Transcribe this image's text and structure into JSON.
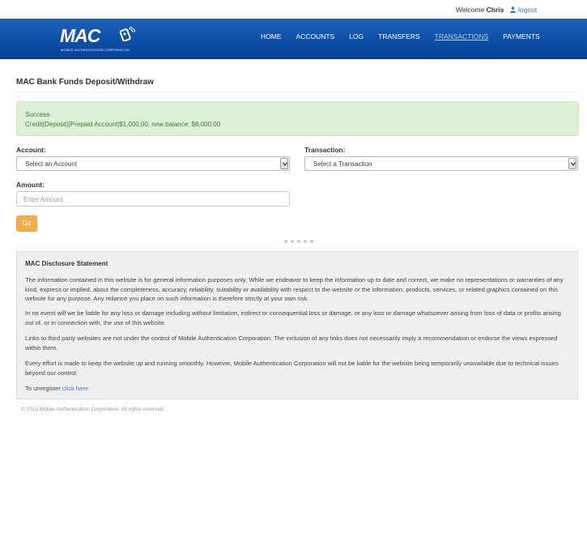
{
  "topbar": {
    "welcome_prefix": "Welcome",
    "user_name": "Chris",
    "logout_label": "logout",
    "logout_icon": "user-icon"
  },
  "brand": {
    "logo_text": "MAC",
    "logo_subtitle": "MOBILE AUTHENTICATION CORPORATION",
    "nav_bg": "#0d4ea6"
  },
  "nav": {
    "items": [
      {
        "label": "HOME"
      },
      {
        "label": "ACCOUNTS"
      },
      {
        "label": "LOG"
      },
      {
        "label": "TRANSFERS"
      },
      {
        "label": "TRANSACTIONS",
        "active": true
      },
      {
        "label": "PAYMENTS"
      }
    ]
  },
  "page": {
    "title": "MAC Bank Funds Deposit/Withdraw"
  },
  "alert": {
    "title": "Success",
    "message": "Credit(Deposit)|Prepaid Account|$1,000.00, new balance: $6,000.00"
  },
  "form": {
    "account_label": "Account:",
    "account_value": "Select an Account",
    "transaction_label": "Transaction:",
    "transaction_value": "Select a Transaction",
    "amount_label": "Amount:",
    "amount_placeholder": "Enter Amount",
    "go_label": "Go"
  },
  "disclosure": {
    "heading": "MAC Disclosure Statement",
    "p1": "The information contained in this website is for general information purposes only. While we endeavor to keep the information up to date and correct, we make no representations or warranties of any kind, express or implied, about the completeness, accuracy, reliability, suitability or availability with respect to the website or the information, products, services, or related graphics contained on this website for any purpose. Any reliance you place on such information is therefore strictly at your own risk.",
    "p2": "In no event will we be liable for any loss or damage including without limitation, indirect or consequential loss or damage, or any loss or damage whatsoever arising from loss of data or profits arising out of, or in connection with, the use of this website.",
    "p3": "Links to third party websites are not under the control of Mobile Authentication Corporation. The inclusion of any links does not necessarily imply a recommendation or endorse the views expressed within them.",
    "p4": "Every effort is made to keep the website up and running smoothly. However, Mobile Authentication Corporation will not be liable for the website being temporarily unavailable due to technical issues beyond our control.",
    "unregister_prefix": "To unregister",
    "unregister_link": "click here"
  },
  "footer": {
    "copyright": "© 2015 Mobile Authentication Corporation. All rights reserved."
  }
}
